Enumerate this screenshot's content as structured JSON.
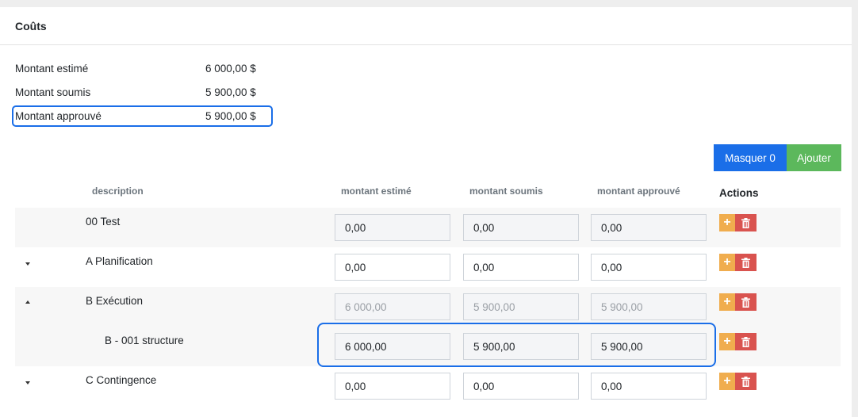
{
  "card": {
    "title": "Coûts"
  },
  "summary": [
    {
      "label": "Montant estimé",
      "value": "6 000,00 $"
    },
    {
      "label": "Montant soumis",
      "value": "5 900,00 $"
    },
    {
      "label": "Montant approuvé",
      "value": "5 900,00 $"
    }
  ],
  "buttons": {
    "masquer": "Masquer 0",
    "ajouter": "Ajouter"
  },
  "table": {
    "headers": {
      "description": "description",
      "estimated": "montant estimé",
      "submitted": "montant soumis",
      "approved": "montant approuvé",
      "actions": "Actions"
    },
    "rows": [
      {
        "description": "00 Test",
        "estimated": "0,00",
        "submitted": "0,00",
        "approved": "0,00"
      },
      {
        "description": "A Planification",
        "estimated": "0,00",
        "submitted": "0,00",
        "approved": "0,00"
      },
      {
        "description": "B Exécution",
        "estimated": "6 000,00",
        "submitted": "5 900,00",
        "approved": "5 900,00"
      },
      {
        "description": "B - 001 structure",
        "estimated": "6 000,00",
        "submitted": "5 900,00",
        "approved": "5 900,00"
      },
      {
        "description": "C Contingence",
        "estimated": "0,00",
        "submitted": "0,00",
        "approved": "0,00"
      }
    ]
  },
  "colors": {
    "primary": "#1a6ee8",
    "success": "#5cb85c",
    "warning": "#f0ad4e",
    "danger": "#d9534f"
  },
  "icons": {
    "add": "plus-icon",
    "delete": "trash-icon",
    "expand": "caret-down-icon",
    "collapse": "caret-up-icon"
  }
}
